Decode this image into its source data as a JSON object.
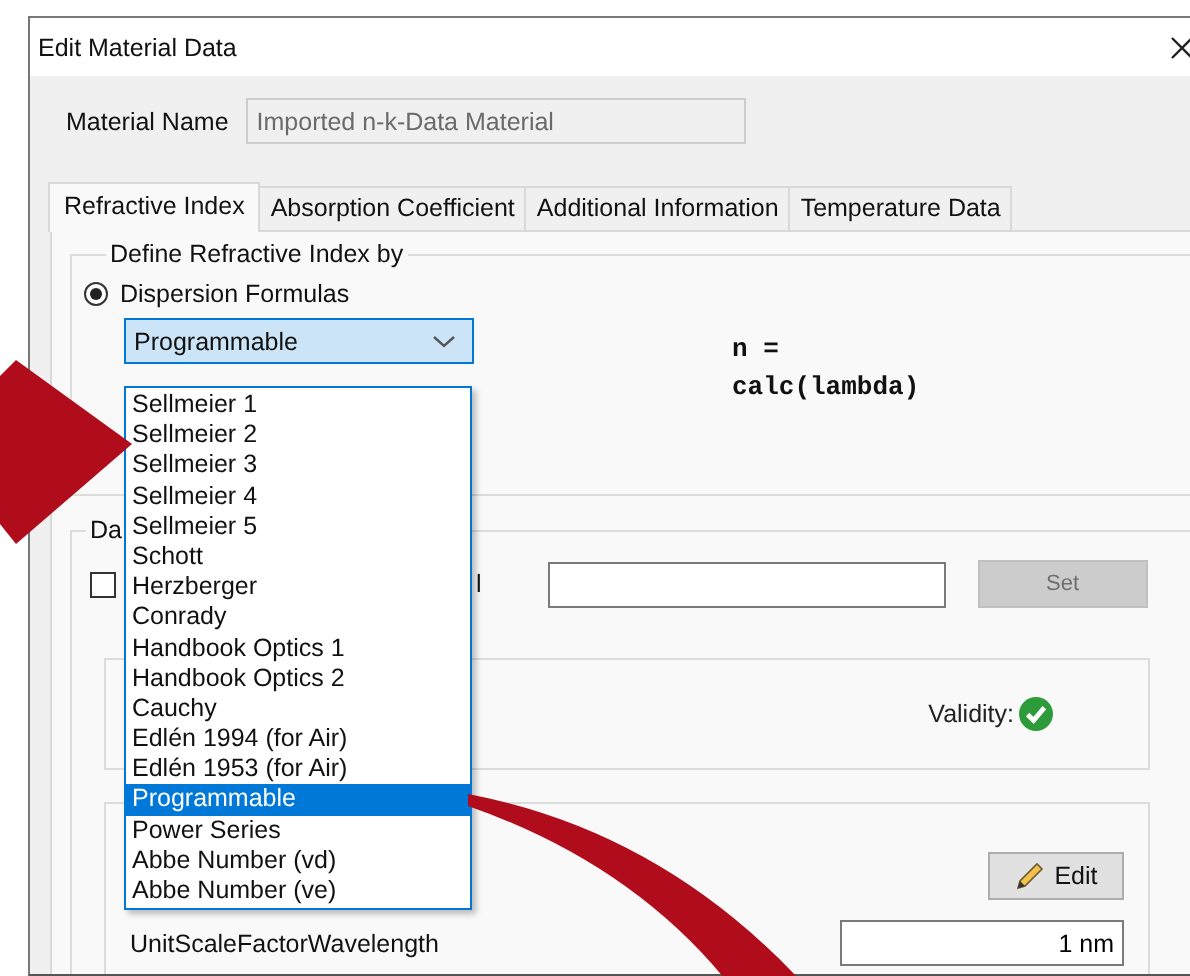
{
  "window": {
    "title": "Edit Material Data"
  },
  "material_name": {
    "label": "Material Name",
    "value": "Imported n-k-Data Material",
    "disabled": true
  },
  "tabs": [
    {
      "label": "Refractive Index",
      "selected": true
    },
    {
      "label": "Absorption Coefficient",
      "selected": false
    },
    {
      "label": "Additional Information",
      "selected": false
    },
    {
      "label": "Temperature Data",
      "selected": false
    }
  ],
  "define_group": {
    "title": "Define Refractive Index by",
    "radios": [
      {
        "label": "Dispersion Formulas",
        "selected": true
      }
    ],
    "formula_dropdown": {
      "value": "Programmable",
      "expanded": true,
      "options": [
        {
          "label": "Sellmeier 1",
          "selected": false
        },
        {
          "label": "Sellmeier 2",
          "selected": false
        },
        {
          "label": "Sellmeier 3",
          "selected": false
        },
        {
          "label": "Sellmeier 4",
          "selected": false
        },
        {
          "label": "Sellmeier 5",
          "selected": false
        },
        {
          "label": "Schott",
          "selected": false
        },
        {
          "label": "Herzberger",
          "selected": false
        },
        {
          "label": "Conrady",
          "selected": false
        },
        {
          "label": "Handbook Optics 1",
          "selected": false
        },
        {
          "label": "Handbook Optics 2",
          "selected": false
        },
        {
          "label": "Cauchy",
          "selected": false
        },
        {
          "label": "Edlén 1994 (for Air)",
          "selected": false
        },
        {
          "label": "Edlén 1953 (for Air)",
          "selected": false
        },
        {
          "label": "Programmable",
          "selected": true
        },
        {
          "label": "Power Series",
          "selected": false
        },
        {
          "label": "Abbe Number (vd)",
          "selected": false
        },
        {
          "label": "Abbe Number (ve)",
          "selected": false
        }
      ]
    },
    "formula_text": [
      "n =",
      "calc(lambda)"
    ]
  },
  "data_group": {
    "title": "Da",
    "checkbox": {
      "label": "l",
      "checked": false
    },
    "set_button": {
      "label": "Set",
      "disabled": true
    },
    "validity": {
      "label": "Validity:",
      "valid": true
    },
    "edit_button": {
      "label": "Edit"
    },
    "unit_scale": {
      "label": "UnitScaleFactorWavelength",
      "value": "1 nm"
    }
  }
}
